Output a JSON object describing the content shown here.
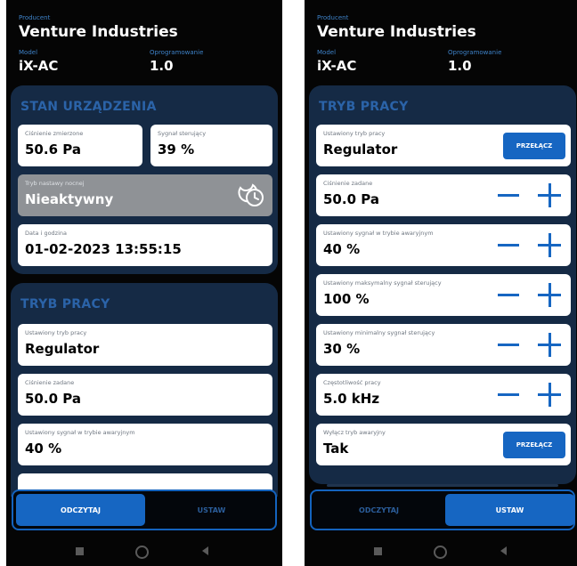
{
  "device": {
    "producer_label": "Producent",
    "producer": "Venture Industries",
    "model_label": "Model",
    "model": "iX-AC",
    "firmware_label": "Oprogramowanie",
    "firmware": "1.0"
  },
  "left": {
    "status_section": {
      "title": "STAN URZĄDZENIA",
      "pressure_label": "Ciśnienie zmierzone",
      "pressure_value": "50.6 Pa",
      "signal_label": "Sygnał sterujący",
      "signal_value": "39 %",
      "night_label": "Tryb nastawy nocnej",
      "night_value": "Nieaktywny",
      "datetime_label": "Data i godzina",
      "datetime_value": "01-02-2023 13:55:15"
    },
    "mode_section": {
      "title": "TRYB PRACY",
      "mode_label": "Ustawiony tryb pracy",
      "mode_value": "Regulator",
      "setpoint_label": "Ciśnienie zadane",
      "setpoint_value": "50.0 Pa",
      "emergency_label": "Ustawiony sygnał w trybie awaryjnym",
      "emergency_value": "40 %"
    },
    "tabs": {
      "read": "ODCZYTAJ",
      "set": "USTAW",
      "active": "read"
    }
  },
  "right": {
    "firmware_label": "Oprogramowanie",
    "mode_section": {
      "title": "TRYB PRACY",
      "switch_label": "PRZEŁĄCZ",
      "rows": [
        {
          "label": "Ustawiony tryb pracy",
          "value": "Regulator",
          "control": "switch"
        },
        {
          "label": "Ciśnienie zadane",
          "value": "50.0 Pa",
          "control": "stepper"
        },
        {
          "label": "Ustawiony sygnał w trybie awaryjnym",
          "value": "40 %",
          "control": "stepper"
        },
        {
          "label": "Ustawiony maksymalny sygnał sterujący",
          "value": "100 %",
          "control": "stepper"
        },
        {
          "label": "Ustawiony minimalny sygnał sterujący",
          "value": "30 %",
          "control": "stepper"
        },
        {
          "label": "Częstotliwość pracy",
          "value": "5.0 kHz",
          "control": "stepper"
        },
        {
          "label": "Wyłącz tryb awaryjny",
          "value": "Tak",
          "control": "switch"
        }
      ]
    },
    "tabs": {
      "read": "ODCZYTAJ",
      "set": "USTAW",
      "active": "set"
    }
  },
  "colors": {
    "accent": "#1666c2",
    "section_bg": "#152a45",
    "section_title": "#2b63a8",
    "screen_bg": "#050505"
  }
}
